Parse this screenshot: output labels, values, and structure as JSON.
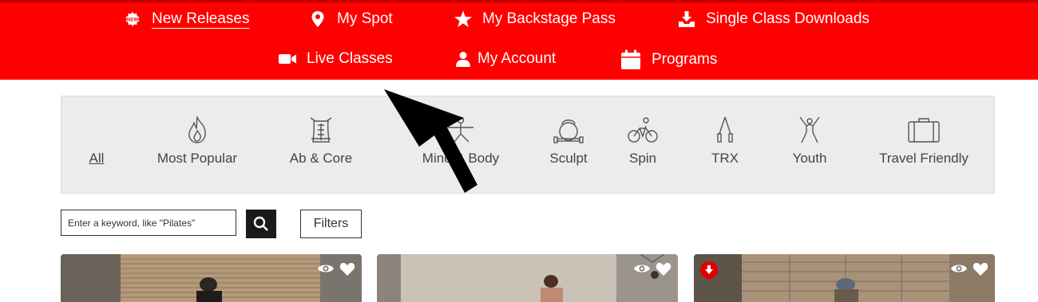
{
  "nav": {
    "items": [
      {
        "label": "New Releases",
        "icon": "badge-icon",
        "active": true
      },
      {
        "label": "My Spot",
        "icon": "map-pin-icon"
      },
      {
        "label": "My Backstage Pass",
        "icon": "star-icon"
      },
      {
        "label": "Single Class Downloads",
        "icon": "download-tray-icon"
      },
      {
        "label": "Live Classes",
        "icon": "video-camera-icon"
      },
      {
        "label": "My Account",
        "icon": "user-icon"
      },
      {
        "label": "Programs",
        "icon": "calendar-icon"
      }
    ],
    "bg_color": "#ff0000"
  },
  "categories": [
    {
      "label": "All",
      "icon": ""
    },
    {
      "label": "Most Popular",
      "icon": "flame-icon"
    },
    {
      "label": "Ab & Core",
      "icon": "torso-icon"
    },
    {
      "label": "Mind & Body",
      "icon": "yoga-pose-icon"
    },
    {
      "label": "Sculpt",
      "icon": "kettlebell-icon"
    },
    {
      "label": "Spin",
      "icon": "cyclist-icon"
    },
    {
      "label": "TRX",
      "icon": "straps-icon"
    },
    {
      "label": "Youth",
      "icon": "jumping-person-icon"
    },
    {
      "label": "Travel Friendly",
      "icon": "suitcase-icon"
    }
  ],
  "search": {
    "placeholder": "Enter a keyword, like \"Pilates\""
  },
  "filters_label": "Filters",
  "cards": [
    {
      "has_download_badge": false,
      "icons": [
        "eye-icon",
        "heart-icon"
      ]
    },
    {
      "has_download_badge": false,
      "icons": [
        "eye-icon",
        "heart-icon"
      ]
    },
    {
      "has_download_badge": true,
      "icons": [
        "eye-icon",
        "heart-icon"
      ]
    }
  ]
}
